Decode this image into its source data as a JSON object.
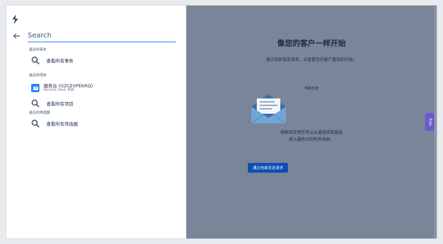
{
  "search": {
    "placeholder": "Search"
  },
  "sections": {
    "recent_issues": {
      "title": "最近的事务",
      "view_all": "查看所有事务"
    },
    "recent_projects": {
      "title": "最近的项目",
      "project": {
        "name": "服务台 (GZCEXPEKRQ)",
        "type": "Service Desk 项目"
      },
      "view_all": "查看所有项目"
    },
    "recent_filters": {
      "title": "最近的筛选器",
      "view_all": "查看所有筛选器"
    }
  },
  "overlay": {
    "title": "像您的客户一样开始",
    "subtitle": "通过电邮发送请求，以查看您的客户看到的内容。",
    "caption": "电邮支持",
    "description_line1": "电邮支持使您可以从通道获取直接",
    "description_line2": "进入服务台的所有电邮。",
    "button": "通过电邮发送请求"
  },
  "help_tab": "Help",
  "colors": {
    "overlay": "#7a8599",
    "accent": "#2684ff",
    "button": "#0b4fb3",
    "help_tab": "#6a5acd"
  },
  "icons": {
    "logo": "jira-logo-icon",
    "back": "arrow-left-icon",
    "search": "search-icon",
    "project_avatar": "project-avatar-icon",
    "envelope": "envelope-icon"
  }
}
